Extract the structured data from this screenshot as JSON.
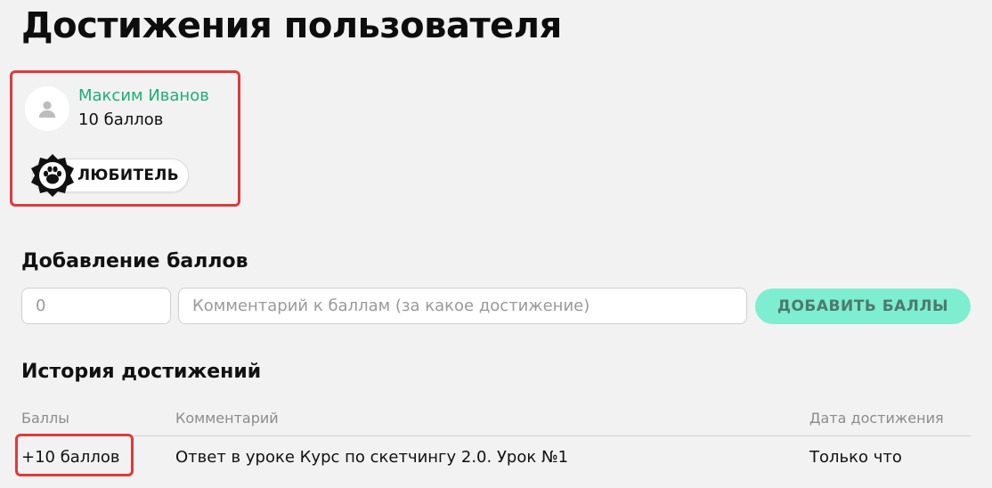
{
  "page": {
    "title": "Достижения пользователя"
  },
  "user": {
    "name": "Максим Иванов",
    "points": "10 баллов",
    "level": "ЛЮБИТЕЛЬ"
  },
  "add_points": {
    "title": "Добавление баллов",
    "points_placeholder": "0",
    "comment_placeholder": "Комментарий к баллам (за какое достижение)",
    "button_label": "ДОБАВИТЬ БАЛЛЫ"
  },
  "history": {
    "title": "История достижений",
    "columns": [
      "Баллы",
      "Комментарий",
      "Дата достижения"
    ],
    "rows": [
      {
        "points": "+10 баллов",
        "comment": "Ответ в уроке Курс по скетчингу 2.0. Урок №1",
        "date": "Только что"
      }
    ]
  },
  "colors": {
    "accent_green": "#1dae79",
    "button_bg": "#7eeed0",
    "highlight_red": "#e03a3a"
  },
  "icons": {
    "avatar": "user-icon",
    "level": "paw-icon"
  }
}
